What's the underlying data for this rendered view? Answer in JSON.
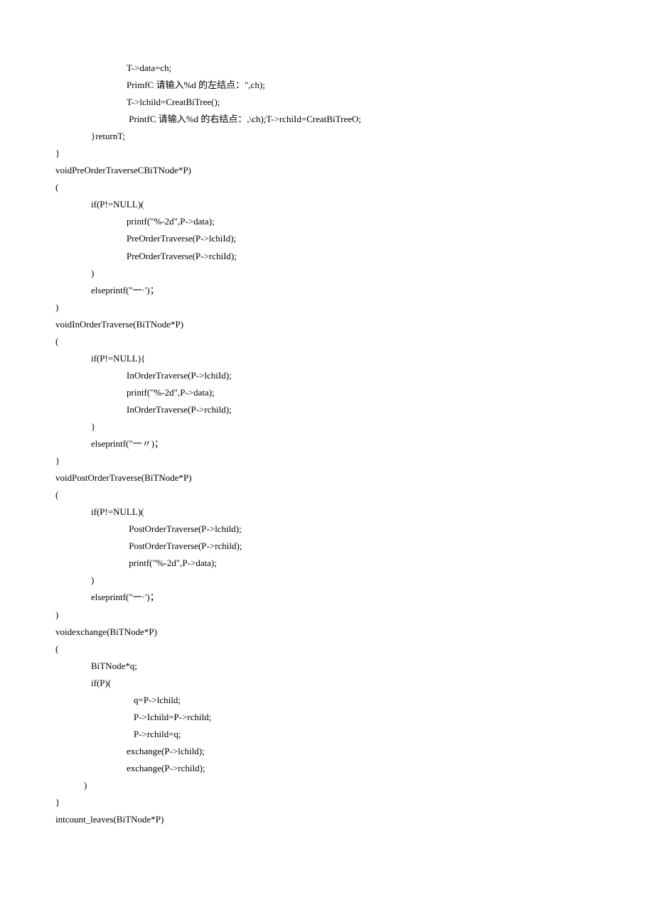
{
  "lines": [
    {
      "cls": "i2",
      "text": "T->data=ch;"
    },
    {
      "cls": "i2",
      "text": "PrimfC 请输入%d 的左结点：\",ch);"
    },
    {
      "cls": "i2",
      "text": "T->lchild=CreatBiTree();"
    },
    {
      "cls": "i2",
      "text": " PrintfC 请输入%d 的右结点：,\\ch);T->rchiId=CreatBiTreeO;"
    },
    {
      "cls": "i1",
      "text": "}returnT;"
    },
    {
      "cls": "i0",
      "text": "}"
    },
    {
      "cls": "i0",
      "text": "voidPreOrderTraverseCBiTNode*P)"
    },
    {
      "cls": "i0",
      "text": "("
    },
    {
      "cls": "i1",
      "text": "if(P!=NULL)("
    },
    {
      "cls": "i2",
      "text": "printf(\"%-2d\",P->data);"
    },
    {
      "cls": "i2",
      "text": "PreOrderTraverse(P->lchiId);"
    },
    {
      "cls": "i2",
      "text": "PreOrderTraverse(P->rchiId);"
    },
    {
      "cls": "i1",
      "text": ")"
    },
    {
      "cls": "i1",
      "text": "elseprintf(\"一·')；"
    },
    {
      "cls": "i0",
      "text": ")"
    },
    {
      "cls": "i0",
      "text": "voidInOrderTraverse(BiTNode*P)"
    },
    {
      "cls": "i0",
      "text": "("
    },
    {
      "cls": "i1",
      "text": "if(P!=NULL){"
    },
    {
      "cls": "i2",
      "text": "InOrderTraverse(P->lchiId);"
    },
    {
      "cls": "i2",
      "text": "printf(\"%-2d\",P->data);"
    },
    {
      "cls": "i2",
      "text": "InOrderTraverse(P->rchild);"
    },
    {
      "cls": "i1",
      "text": "}"
    },
    {
      "cls": "i1",
      "text": "elseprintf(\"一〃)；"
    },
    {
      "cls": "i0",
      "text": "}"
    },
    {
      "cls": "i0",
      "text": "voidPostOrderTraverse(BiTNode*P)"
    },
    {
      "cls": "i0",
      "text": "("
    },
    {
      "cls": "i1",
      "text": "if(P!=NULL)("
    },
    {
      "cls": "i2",
      "text": " PostOrderTraverse(P->lchild);"
    },
    {
      "cls": "i2",
      "text": " PostOrderTraverse(P->rchild);"
    },
    {
      "cls": "i2",
      "text": " printf(\"%-2d\",P->data);"
    },
    {
      "cls": "i1",
      "text": ")"
    },
    {
      "cls": "i1",
      "text": "elseprintf(\"一·')；"
    },
    {
      "cls": "i0",
      "text": ")"
    },
    {
      "cls": "i0",
      "text": "voidexchange(BiTNode*P)"
    },
    {
      "cls": "i0",
      "text": "("
    },
    {
      "cls": "i1",
      "text": "BiTNode*q;"
    },
    {
      "cls": "i1",
      "text": "if(P)("
    },
    {
      "cls": "i3",
      "text": "q=P->lchild;"
    },
    {
      "cls": "i3",
      "text": "P->Ichild=P->rchild;"
    },
    {
      "cls": "i3",
      "text": "P->rchild=q;"
    },
    {
      "cls": "i2",
      "text": "exchange(P->lchild);"
    },
    {
      "cls": "i2",
      "text": "exchange(P->rchild);"
    },
    {
      "cls": "i4",
      "text": ")"
    },
    {
      "cls": "i0",
      "text": "}"
    },
    {
      "cls": "i0",
      "text": "intcount_leaves(BiTNode*P)"
    }
  ]
}
